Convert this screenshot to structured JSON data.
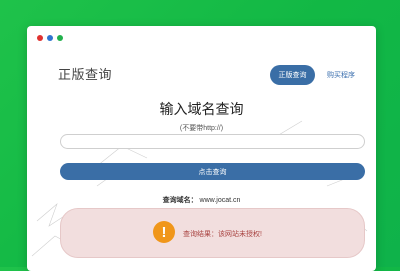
{
  "colors": {
    "background": "#16bb46",
    "accent": "#3a6ea6",
    "window_dots": [
      "#e0312f",
      "#2f74d0",
      "#22b14c"
    ],
    "result_bg": "#f2dede",
    "result_text": "#a94442",
    "warning_icon": "#f0961a"
  },
  "header": {
    "title": "正版查询",
    "nav_active": "正版查询",
    "nav_link": "购买程序"
  },
  "form": {
    "heading": "输入域名查询",
    "hint": "(不要带http://)",
    "input_value": "",
    "submit_label": "点击查询"
  },
  "result": {
    "domain_label": "查询域名：",
    "domain_value": "www.jocat.cn",
    "icon": "warning-exclamation-icon",
    "icon_glyph": "!",
    "message": "查询结果：该网站未授权!"
  }
}
